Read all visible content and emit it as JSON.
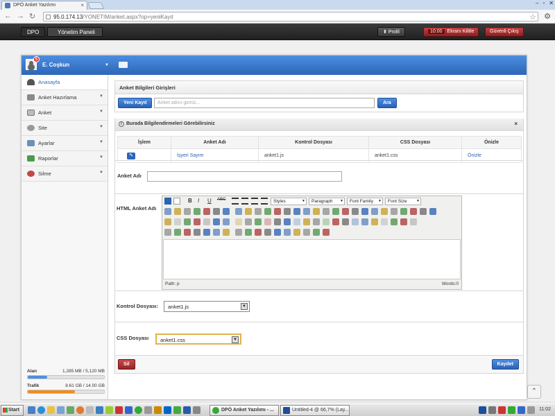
{
  "browser": {
    "tab_title": "DPÖ Anket Yazılımı",
    "url_host": "95.0.174.13",
    "url_path": "/YONETIM/anket.aspx?op=yeniKayıt"
  },
  "topbar": {
    "brand": "DPO",
    "crumb": "Yönetim Paneli",
    "profile": "Profil",
    "timer": "10:00",
    "lock": "Ekranı Kilitle",
    "logout": "Güvenli Çıkış"
  },
  "user": {
    "name": "E. Coşkun",
    "notifications": "5"
  },
  "sidebar": {
    "items": [
      {
        "label": "Anasayfa",
        "active": true,
        "icon": "home-icon"
      },
      {
        "label": "Anket Hazırlama",
        "icon": "list-icon"
      },
      {
        "label": "Anket",
        "icon": "form-icon"
      },
      {
        "label": "Site",
        "icon": "cog-icon"
      },
      {
        "label": "Ayarlar",
        "icon": "settings-icon"
      },
      {
        "label": "Raporlar",
        "icon": "report-icon"
      },
      {
        "label": "Silme",
        "icon": "delete-icon"
      }
    ],
    "stats": {
      "alan_label": "Alan",
      "alan_value": "1,285 MB / 5,120 MB",
      "alan_fraction": 0.25,
      "trafik_label": "Trafik",
      "trafik_value": "8.61 GB / 14.00 GB",
      "trafik_fraction": 0.615
    }
  },
  "main": {
    "panel_title": "Anket Bilgileri Girişleri",
    "new_button": "Yeni Kayıt",
    "search_placeholder": "Anket adını giriniz...",
    "search_button": "Ara",
    "info_text": "Burada Bilgilendirmeleri Görebilirsiniz",
    "info_close": "×",
    "table": {
      "headers": [
        "İşlem",
        "Anket Adı",
        "Kontrol Dosyası",
        "CSS Dosyası",
        "Önizle"
      ],
      "rows": [
        {
          "name": "İşyeri Sayım",
          "control": "anket1.js",
          "css": "anket1.css",
          "preview": "Önizle"
        }
      ]
    },
    "name_label": "Anket Adı",
    "html_label": "HTML Anket Adı",
    "editor": {
      "styles": "Styles",
      "paragraph": "Paragraph",
      "font_family": "Font Family",
      "font_size": "Font Size",
      "path": "Path: p",
      "words": "Words:0"
    },
    "control_label": "Kontrol Dosyası:",
    "control_value": "anket1.js",
    "css_label": "CSS Dosyası",
    "css_value": "anket1.css",
    "delete_button": "Sil",
    "save_button": "Kaydet"
  },
  "taskbar": {
    "start": "Start",
    "task1": "DPÖ Anket Yazılımı - ...",
    "task2": "Untitled-4 @ 66,7% (Lay...",
    "clock": "11:02"
  },
  "colors": {
    "accent": "#2c66b8",
    "danger": "#962525",
    "alan_bar": "#4f8fe0",
    "trafik_bar": "#f08c1c"
  }
}
